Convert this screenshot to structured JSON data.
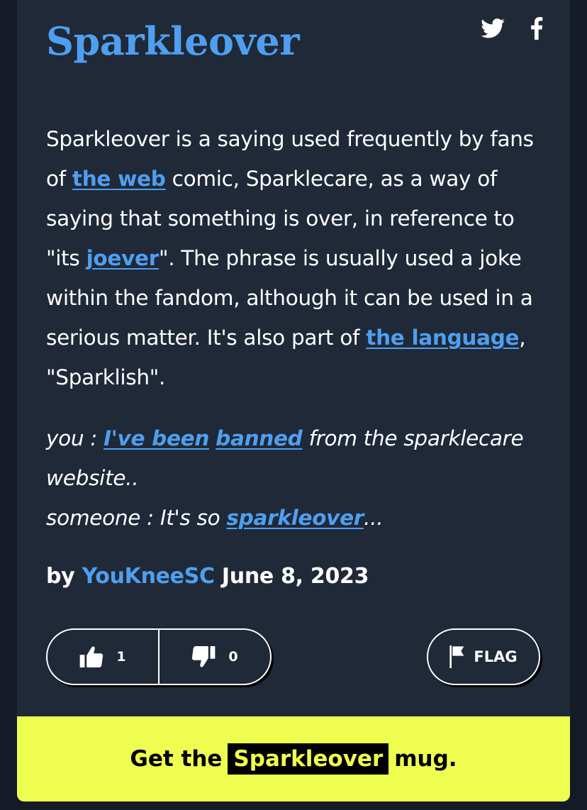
{
  "word": "Sparkleover",
  "share": {
    "twitter_icon": "twitter-icon",
    "facebook_icon": "facebook-icon"
  },
  "meaning": {
    "t1": "Sparkleover is a saying used frequently by fans of ",
    "l1": "the web",
    "t2": " comic, Sparklecare, as a way of saying that something is over, in reference to \"its ",
    "l2": "joever",
    "t3": "\". The phrase is usually used a joke within the fandom, although it can be used in a serious matter. It's also part of ",
    "l3": "the language",
    "t4": ", \"Sparklish\"."
  },
  "example": {
    "t1": "you : ",
    "l1": "I've been",
    "t2": " ",
    "l2": "banned",
    "t3": " from the sparklecare website..",
    "t4": "someone : It's so ",
    "l3": "sparkleover",
    "t5": "..."
  },
  "contributor": {
    "by": "by",
    "author": "YouKneeSC",
    "date": "June 8, 2023"
  },
  "votes": {
    "up": "1",
    "down": "0"
  },
  "flag_label": "FLAG",
  "mug": {
    "pre": "Get the",
    "word": "Sparkleover",
    "post": "mug."
  },
  "colors": {
    "card": "#1f2937",
    "link": "#4f9ff0",
    "banner": "#effd50"
  }
}
